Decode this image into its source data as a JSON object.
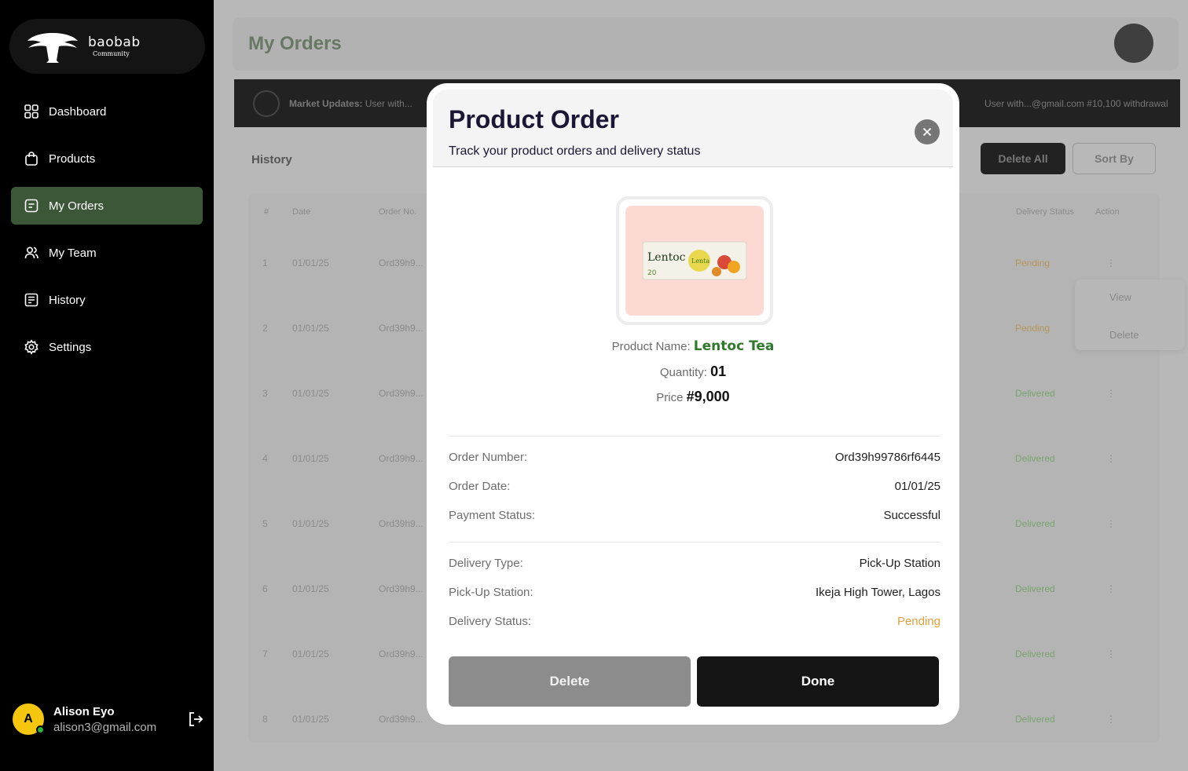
{
  "brand": {
    "name": "baobab",
    "tagline": "Community"
  },
  "nav": [
    {
      "label": "Dashboard",
      "icon": "dashboard-icon"
    },
    {
      "label": "Products",
      "icon": "shopping-bag-icon"
    },
    {
      "label": "My Orders",
      "icon": "orders-icon",
      "active": true
    },
    {
      "label": "My Team",
      "icon": "team-icon"
    },
    {
      "label": "History",
      "icon": "history-icon"
    },
    {
      "label": "Settings",
      "icon": "gear-icon"
    }
  ],
  "user": {
    "initial": "A",
    "name": "Alison Eyo",
    "email": "alison3@gmail.com"
  },
  "page": {
    "title": "My Orders",
    "ticker_label": "Market Updates:",
    "ticker_text": "User with...",
    "ticker_text_right": "User with...@gmail.com #10,100 withdrawal",
    "section": "History",
    "delete_all": "Delete All",
    "sort_by": "Sort By",
    "columns": [
      "#",
      "Date",
      "Order No.",
      "Delivery Status",
      "Action"
    ],
    "rows": [
      {
        "n": "1",
        "date": "01/01/25",
        "order": "Ord39h9...",
        "status": "Pending"
      },
      {
        "n": "2",
        "date": "01/01/25",
        "order": "Ord39h9...",
        "status": "Pending"
      },
      {
        "n": "3",
        "date": "01/01/25",
        "order": "Ord39h9...",
        "status": "Delivered"
      },
      {
        "n": "4",
        "date": "01/01/25",
        "order": "Ord39h9...",
        "status": "Delivered"
      },
      {
        "n": "5",
        "date": "01/01/25",
        "order": "Ord39h9...",
        "status": "Delivered"
      },
      {
        "n": "6",
        "date": "01/01/25",
        "order": "Ord39h9...",
        "status": "Delivered"
      },
      {
        "n": "7",
        "date": "01/01/25",
        "order": "Ord39h9...",
        "status": "Delivered"
      },
      {
        "n": "8",
        "date": "01/01/25",
        "order": "Ord39h9...",
        "status": "Delivered"
      }
    ],
    "row_menu": {
      "view": "View",
      "delete": "Delete"
    }
  },
  "modal": {
    "title": "Product Order",
    "subtitle": "Track your product orders and delivery status",
    "product_name_label": "Product Name:",
    "product_name": "Lentoc Tea",
    "quantity_label": "Quantity:",
    "quantity": "01",
    "price_label": "Price",
    "price": "#9,000",
    "details": [
      {
        "key": "Order Number:",
        "value": "Ord39h99786rf6445"
      },
      {
        "key": "Order Date:",
        "value": "01/01/25"
      },
      {
        "key": "Payment Status:",
        "value": "Successful"
      }
    ],
    "delivery": [
      {
        "key": "Delivery Type:",
        "value": "Pick-Up Station"
      },
      {
        "key": "Pick-Up Station:",
        "value": "Ikeja High Tower, Lagos"
      },
      {
        "key": "Delivery Status:",
        "value": "Pending"
      }
    ],
    "delete_label": "Delete",
    "done_label": "Done",
    "colors": {
      "pending": "#e0a13a",
      "accent": "#3c5738"
    }
  }
}
